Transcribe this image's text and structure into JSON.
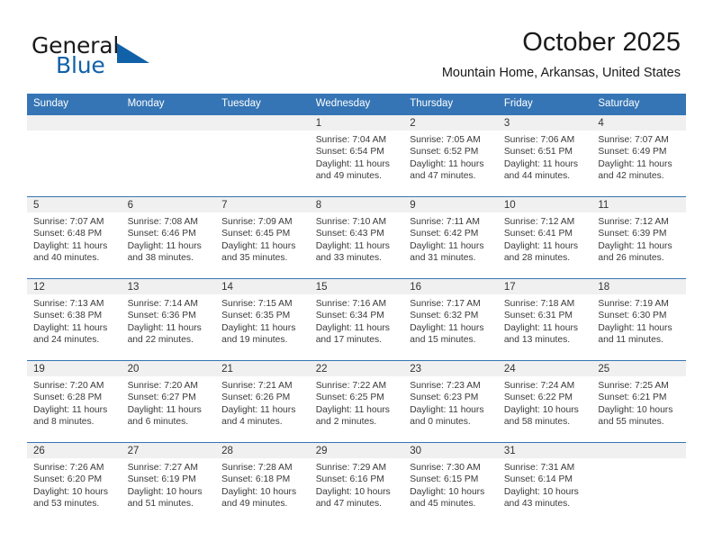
{
  "brand": {
    "name_part1": "General",
    "name_part2": "Blue"
  },
  "header": {
    "title": "October 2025",
    "location": "Mountain Home, Arkansas, United States"
  },
  "colors": {
    "header_blue": "#3575b5",
    "brand_blue": "#1061a8",
    "daynum_band": "#f0f0f0",
    "text": "#3a3a3a"
  },
  "weekday_headers": [
    "Sunday",
    "Monday",
    "Tuesday",
    "Wednesday",
    "Thursday",
    "Friday",
    "Saturday"
  ],
  "weeks": [
    [
      {
        "day": "",
        "sunrise": "",
        "sunset": "",
        "daylight1": "",
        "daylight2": ""
      },
      {
        "day": "",
        "sunrise": "",
        "sunset": "",
        "daylight1": "",
        "daylight2": ""
      },
      {
        "day": "",
        "sunrise": "",
        "sunset": "",
        "daylight1": "",
        "daylight2": ""
      },
      {
        "day": "1",
        "sunrise": "Sunrise: 7:04 AM",
        "sunset": "Sunset: 6:54 PM",
        "daylight1": "Daylight: 11 hours",
        "daylight2": "and 49 minutes."
      },
      {
        "day": "2",
        "sunrise": "Sunrise: 7:05 AM",
        "sunset": "Sunset: 6:52 PM",
        "daylight1": "Daylight: 11 hours",
        "daylight2": "and 47 minutes."
      },
      {
        "day": "3",
        "sunrise": "Sunrise: 7:06 AM",
        "sunset": "Sunset: 6:51 PM",
        "daylight1": "Daylight: 11 hours",
        "daylight2": "and 44 minutes."
      },
      {
        "day": "4",
        "sunrise": "Sunrise: 7:07 AM",
        "sunset": "Sunset: 6:49 PM",
        "daylight1": "Daylight: 11 hours",
        "daylight2": "and 42 minutes."
      }
    ],
    [
      {
        "day": "5",
        "sunrise": "Sunrise: 7:07 AM",
        "sunset": "Sunset: 6:48 PM",
        "daylight1": "Daylight: 11 hours",
        "daylight2": "and 40 minutes."
      },
      {
        "day": "6",
        "sunrise": "Sunrise: 7:08 AM",
        "sunset": "Sunset: 6:46 PM",
        "daylight1": "Daylight: 11 hours",
        "daylight2": "and 38 minutes."
      },
      {
        "day": "7",
        "sunrise": "Sunrise: 7:09 AM",
        "sunset": "Sunset: 6:45 PM",
        "daylight1": "Daylight: 11 hours",
        "daylight2": "and 35 minutes."
      },
      {
        "day": "8",
        "sunrise": "Sunrise: 7:10 AM",
        "sunset": "Sunset: 6:43 PM",
        "daylight1": "Daylight: 11 hours",
        "daylight2": "and 33 minutes."
      },
      {
        "day": "9",
        "sunrise": "Sunrise: 7:11 AM",
        "sunset": "Sunset: 6:42 PM",
        "daylight1": "Daylight: 11 hours",
        "daylight2": "and 31 minutes."
      },
      {
        "day": "10",
        "sunrise": "Sunrise: 7:12 AM",
        "sunset": "Sunset: 6:41 PM",
        "daylight1": "Daylight: 11 hours",
        "daylight2": "and 28 minutes."
      },
      {
        "day": "11",
        "sunrise": "Sunrise: 7:12 AM",
        "sunset": "Sunset: 6:39 PM",
        "daylight1": "Daylight: 11 hours",
        "daylight2": "and 26 minutes."
      }
    ],
    [
      {
        "day": "12",
        "sunrise": "Sunrise: 7:13 AM",
        "sunset": "Sunset: 6:38 PM",
        "daylight1": "Daylight: 11 hours",
        "daylight2": "and 24 minutes."
      },
      {
        "day": "13",
        "sunrise": "Sunrise: 7:14 AM",
        "sunset": "Sunset: 6:36 PM",
        "daylight1": "Daylight: 11 hours",
        "daylight2": "and 22 minutes."
      },
      {
        "day": "14",
        "sunrise": "Sunrise: 7:15 AM",
        "sunset": "Sunset: 6:35 PM",
        "daylight1": "Daylight: 11 hours",
        "daylight2": "and 19 minutes."
      },
      {
        "day": "15",
        "sunrise": "Sunrise: 7:16 AM",
        "sunset": "Sunset: 6:34 PM",
        "daylight1": "Daylight: 11 hours",
        "daylight2": "and 17 minutes."
      },
      {
        "day": "16",
        "sunrise": "Sunrise: 7:17 AM",
        "sunset": "Sunset: 6:32 PM",
        "daylight1": "Daylight: 11 hours",
        "daylight2": "and 15 minutes."
      },
      {
        "day": "17",
        "sunrise": "Sunrise: 7:18 AM",
        "sunset": "Sunset: 6:31 PM",
        "daylight1": "Daylight: 11 hours",
        "daylight2": "and 13 minutes."
      },
      {
        "day": "18",
        "sunrise": "Sunrise: 7:19 AM",
        "sunset": "Sunset: 6:30 PM",
        "daylight1": "Daylight: 11 hours",
        "daylight2": "and 11 minutes."
      }
    ],
    [
      {
        "day": "19",
        "sunrise": "Sunrise: 7:20 AM",
        "sunset": "Sunset: 6:28 PM",
        "daylight1": "Daylight: 11 hours",
        "daylight2": "and 8 minutes."
      },
      {
        "day": "20",
        "sunrise": "Sunrise: 7:20 AM",
        "sunset": "Sunset: 6:27 PM",
        "daylight1": "Daylight: 11 hours",
        "daylight2": "and 6 minutes."
      },
      {
        "day": "21",
        "sunrise": "Sunrise: 7:21 AM",
        "sunset": "Sunset: 6:26 PM",
        "daylight1": "Daylight: 11 hours",
        "daylight2": "and 4 minutes."
      },
      {
        "day": "22",
        "sunrise": "Sunrise: 7:22 AM",
        "sunset": "Sunset: 6:25 PM",
        "daylight1": "Daylight: 11 hours",
        "daylight2": "and 2 minutes."
      },
      {
        "day": "23",
        "sunrise": "Sunrise: 7:23 AM",
        "sunset": "Sunset: 6:23 PM",
        "daylight1": "Daylight: 11 hours",
        "daylight2": "and 0 minutes."
      },
      {
        "day": "24",
        "sunrise": "Sunrise: 7:24 AM",
        "sunset": "Sunset: 6:22 PM",
        "daylight1": "Daylight: 10 hours",
        "daylight2": "and 58 minutes."
      },
      {
        "day": "25",
        "sunrise": "Sunrise: 7:25 AM",
        "sunset": "Sunset: 6:21 PM",
        "daylight1": "Daylight: 10 hours",
        "daylight2": "and 55 minutes."
      }
    ],
    [
      {
        "day": "26",
        "sunrise": "Sunrise: 7:26 AM",
        "sunset": "Sunset: 6:20 PM",
        "daylight1": "Daylight: 10 hours",
        "daylight2": "and 53 minutes."
      },
      {
        "day": "27",
        "sunrise": "Sunrise: 7:27 AM",
        "sunset": "Sunset: 6:19 PM",
        "daylight1": "Daylight: 10 hours",
        "daylight2": "and 51 minutes."
      },
      {
        "day": "28",
        "sunrise": "Sunrise: 7:28 AM",
        "sunset": "Sunset: 6:18 PM",
        "daylight1": "Daylight: 10 hours",
        "daylight2": "and 49 minutes."
      },
      {
        "day": "29",
        "sunrise": "Sunrise: 7:29 AM",
        "sunset": "Sunset: 6:16 PM",
        "daylight1": "Daylight: 10 hours",
        "daylight2": "and 47 minutes."
      },
      {
        "day": "30",
        "sunrise": "Sunrise: 7:30 AM",
        "sunset": "Sunset: 6:15 PM",
        "daylight1": "Daylight: 10 hours",
        "daylight2": "and 45 minutes."
      },
      {
        "day": "31",
        "sunrise": "Sunrise: 7:31 AM",
        "sunset": "Sunset: 6:14 PM",
        "daylight1": "Daylight: 10 hours",
        "daylight2": "and 43 minutes."
      },
      {
        "day": "",
        "sunrise": "",
        "sunset": "",
        "daylight1": "",
        "daylight2": ""
      }
    ]
  ]
}
